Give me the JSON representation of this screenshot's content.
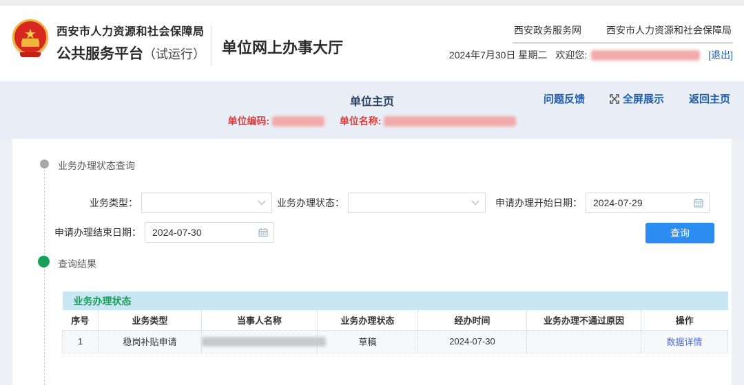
{
  "header": {
    "org_line1": "西安市人力资源和社会保障局",
    "org_line2": "公共服务平台",
    "org_line2_suffix": "（试运行）",
    "portal_title": "单位网上办事大厅",
    "top_links": {
      "gov_portal": "西安政务服务网",
      "hr_bureau": "西安市人力资源和社会保障局"
    },
    "date_text": "2024年7月30日  星期二",
    "welcome_label": "欢迎您:",
    "logout_label": "[退出]"
  },
  "subheader": {
    "page_title": "单位主页",
    "links": {
      "feedback": "问题反馈",
      "fullscreen": "全屏展示",
      "back_home": "返回主页"
    },
    "unit_code_label": "单位编码:",
    "unit_name_label": "单位名称:"
  },
  "query_section": {
    "title": "业务办理状态查询",
    "fields": {
      "biz_type_label": "业务类型：",
      "biz_status_label": "业务办理状态：",
      "start_date_label": "申请办理开始日期：",
      "start_date_value": "2024-07-29",
      "end_date_label": "申请办理结束日期：",
      "end_date_value": "2024-07-30"
    },
    "query_button": "查询"
  },
  "result_section": {
    "title": "查询结果",
    "table": {
      "caption": "业务办理状态",
      "columns": [
        "序号",
        "业务类型",
        "当事人名称",
        "业务办理状态",
        "经办时间",
        "业务办理不通过原因",
        "操作"
      ],
      "rows": [
        {
          "seq": "1",
          "biz_type": "稳岗补贴申请",
          "status": "草稿",
          "time": "2024-07-30",
          "fail_reason": "",
          "action": "数据详情"
        }
      ]
    }
  },
  "icons": {
    "fullscreen": "expand-diagonal-arrows",
    "calendar": "calendar-grid",
    "select": "chevron-down"
  },
  "colors": {
    "accent_button_blue": "#2d8cf0",
    "link_blue": "#1d5cb0",
    "detail_link_blue": "#4a6bdc",
    "alert_red": "#e03a3a",
    "success_green": "#18a058",
    "table_caption_bg": "#c9e6f3",
    "band_bg": "#e9eef6",
    "emblem_red": "#d6281e",
    "emblem_gold": "#eeb33c"
  }
}
